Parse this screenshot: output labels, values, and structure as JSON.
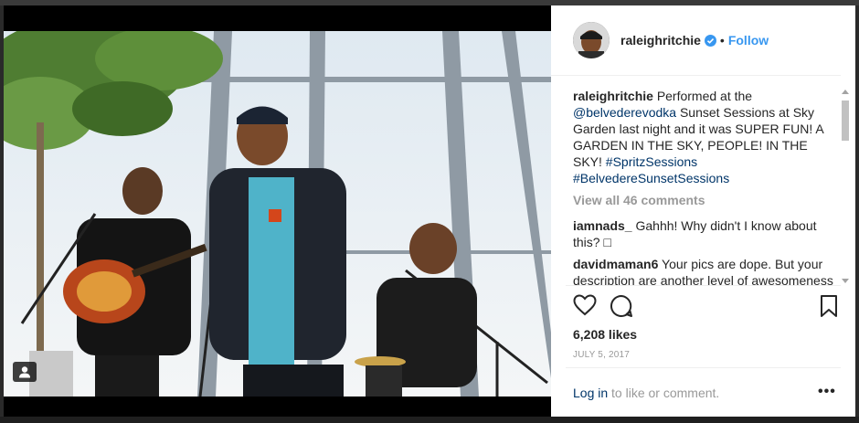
{
  "post": {
    "username": "raleighritchie",
    "follow_label": "Follow",
    "separator": "•",
    "caption": {
      "username": "raleighritchie",
      "text_1": "Performed at the",
      "mention": "@belvederevodka",
      "text_2": "Sunset Sessions at Sky Garden last night and it was SUPER FUN! A GARDEN IN THE SKY, PEOPLE! IN THE SKY!",
      "hashtag_1": "#SpritzSessions",
      "hashtag_2": "#BelvedereSunsetSessions"
    },
    "view_all": "View all 46 comments",
    "comments": [
      {
        "username": "iamnads_",
        "text": "Gahhh! Why didn't I know about this? □"
      },
      {
        "username": "davidmaman6",
        "text": "Your pics are dope. But your description are another level of awesomeness"
      }
    ],
    "likes": "6,208 likes",
    "date": "JULY 5, 2017",
    "login_link": "Log in",
    "login_text": "to like or comment.",
    "more_label": "•••"
  },
  "icons": {
    "like": "heart-icon",
    "comment": "comment-icon",
    "save": "bookmark-icon",
    "verified": "verified-badge-icon",
    "tag": "user-tag-icon"
  },
  "colors": {
    "link_blue": "#3897f0",
    "text_dark": "#262626",
    "muted": "#999999",
    "link_navy": "#003569"
  }
}
